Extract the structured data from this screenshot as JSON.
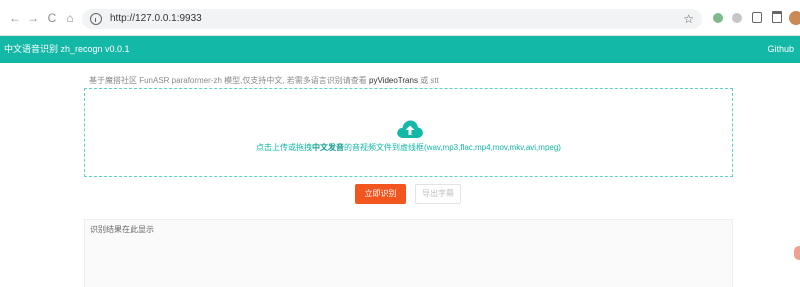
{
  "browser": {
    "back_icon": "←",
    "forward_icon": "→",
    "reload_icon": "C",
    "home_icon": "⌂",
    "url": "http://127.0.0.1:9933",
    "star_icon": "☆"
  },
  "header": {
    "title": "中文语音识别 zh_recogn v0.0.1",
    "github_label": "Github",
    "bg_color": "#14b8a6"
  },
  "intro": {
    "text_prefix": "基于魔搭社区 FunASR paraformer-zh 模型,仅支持中文, 若需多语言识别请查看 ",
    "highlight": "pyVideoTrans",
    "text_suffix": " 或 stt"
  },
  "upload": {
    "prefix": "点击上传或拖拽",
    "strong": "中文发音",
    "suffix": "的音视频文件到虚线框(wav,mp3,flac,mp4,mov,mkv,avi,mpeg)",
    "accent_color": "#14b8a6"
  },
  "actions": {
    "recognize_label": "立即识别",
    "export_label": "导出字幕",
    "primary_color": "#f2551e"
  },
  "result": {
    "placeholder": "识别结果在此显示"
  }
}
